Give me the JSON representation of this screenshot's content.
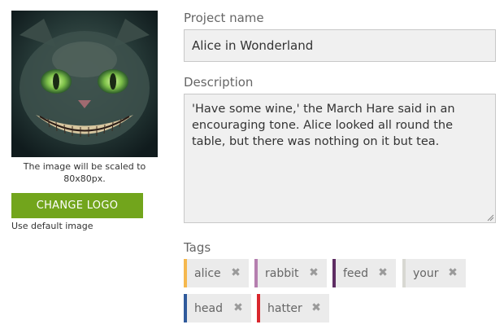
{
  "logo": {
    "note": "The image will be scaled to 80x80px.",
    "change_button": "CHANGE LOGO",
    "default_link": "Use default image"
  },
  "form": {
    "name_label": "Project name",
    "name_value": "Alice in Wonderland",
    "description_label": "Description",
    "description_value": "'Have some wine,' the March Hare said in an encouraging tone. Alice looked all round the table, but there was nothing on it but tea.",
    "tags_label": "Tags",
    "tags": [
      {
        "label": "alice",
        "color": "#f5b84e"
      },
      {
        "label": "rabbit",
        "color": "#b57faf"
      },
      {
        "label": "feed",
        "color": "#5e2d63"
      },
      {
        "label": "your",
        "color": "#d8d8d2"
      },
      {
        "label": "head",
        "color": "#2f5a9b"
      },
      {
        "label": "hatter",
        "color": "#d9272d"
      }
    ],
    "remove_icon": "close-icon"
  },
  "colors": {
    "accent_green": "#72a51c",
    "field_bg": "#f0f0f0",
    "tag_bg": "#ebebeb"
  }
}
